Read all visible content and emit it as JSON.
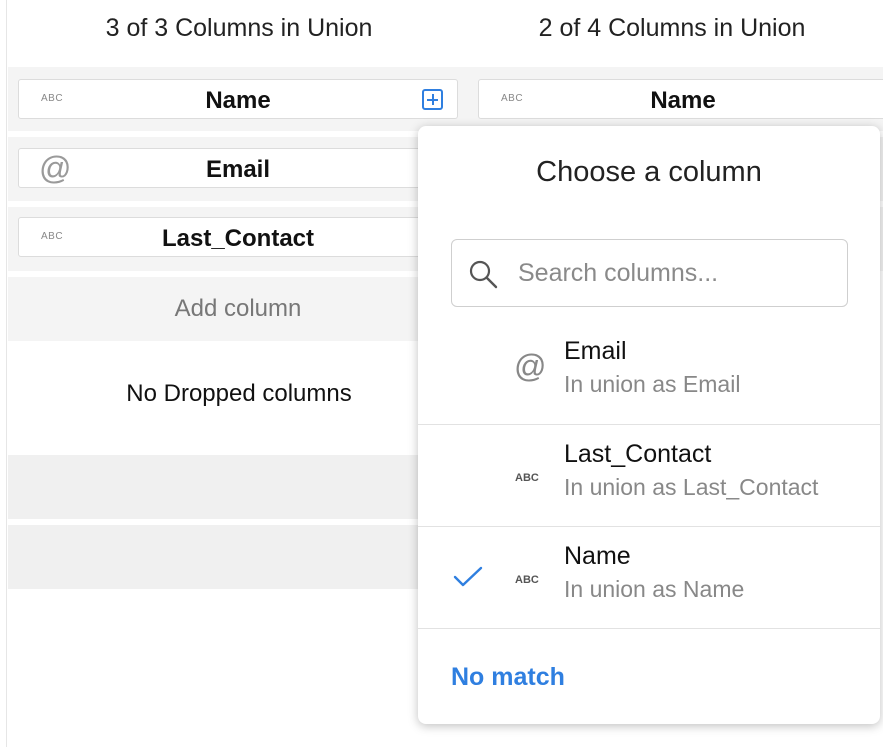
{
  "headers": {
    "left": "3 of 3 Columns in Union",
    "right": "2 of 4 Columns in Union"
  },
  "left_columns": [
    {
      "type": "ABC",
      "name": "Name"
    },
    {
      "type": "@",
      "name": "Email"
    },
    {
      "type": "ABC",
      "name": "Last_Contact"
    }
  ],
  "right_columns": [
    {
      "type": "ABC",
      "name": "Name"
    }
  ],
  "add_column_label": "Add column",
  "no_dropped_label": "No Dropped columns",
  "popover": {
    "title": "Choose a column",
    "search_placeholder": "Search columns...",
    "options": [
      {
        "type": "@",
        "name": "Email",
        "subtitle": "In union as Email",
        "selected": false
      },
      {
        "type": "ABC",
        "name": "Last_Contact",
        "subtitle": "In union as Last_Contact",
        "selected": false
      },
      {
        "type": "ABC",
        "name": "Name",
        "subtitle": "In union as Name",
        "selected": true
      }
    ],
    "no_match_label": "No match"
  },
  "colors": {
    "accent": "#2f7fe0"
  }
}
